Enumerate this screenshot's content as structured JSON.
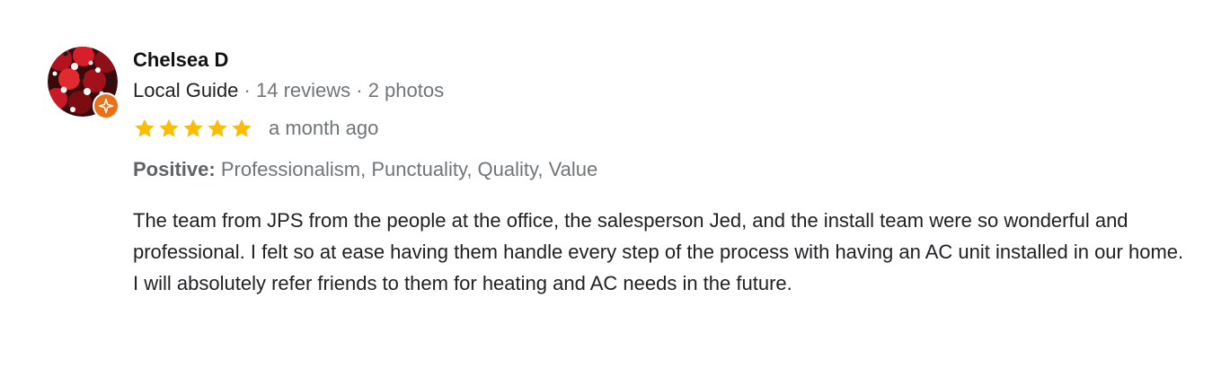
{
  "reviewer": {
    "name": "Chelsea D",
    "guide_label": "Local Guide",
    "separator": " · ",
    "reviews_count": "14 reviews",
    "photos_count": "2 photos",
    "avatar_icon": "avatar-photo",
    "badge_icon": "local-guide-star-icon"
  },
  "rating": {
    "stars": 5,
    "max_stars": 5,
    "date": "a month ago",
    "star_color": "#fbbc04"
  },
  "attributes": {
    "label": "Positive:",
    "values": "Professionalism, Punctuality, Quality, Value"
  },
  "review": {
    "text": "The team from JPS from the people at the office, the salesperson Jed, and the install team were so wonderful and professional. I felt so at ease having them handle every step of the process with having an AC unit installed in our home. I will absolutely refer friends to them for heating and AC needs in the future."
  },
  "colors": {
    "badge": "#e8711a",
    "meta_text": "#70757a",
    "body_text": "#202124"
  }
}
